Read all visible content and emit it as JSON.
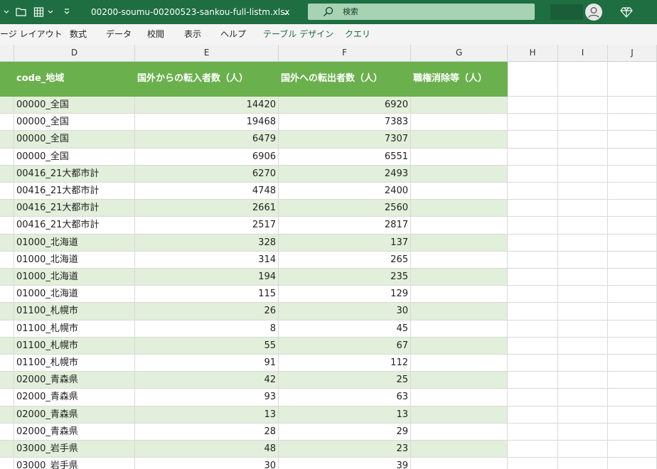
{
  "titlebar": {
    "filename": "00200-soumu-00200523-sankou-full-listm.xlsx",
    "filename_chevron": "⌄",
    "search_label": "検索",
    "icons": [
      "chevron-down-icon",
      "folder-icon",
      "table-icon",
      "dropdown-icon",
      "search-icon",
      "avatar-icon",
      "diamond-icon"
    ]
  },
  "menu": {
    "items": [
      {
        "label": "ージ レイアウト",
        "contextual": false
      },
      {
        "label": "数式",
        "contextual": false
      },
      {
        "label": "データ",
        "contextual": false
      },
      {
        "label": "校閲",
        "contextual": false
      },
      {
        "label": "表示",
        "contextual": false
      },
      {
        "label": "ヘルプ",
        "contextual": false
      },
      {
        "label": "テーブル デザイン",
        "contextual": true
      },
      {
        "label": "クエリ",
        "contextual": true
      }
    ]
  },
  "columns": [
    "D",
    "E",
    "F",
    "G",
    "H",
    "I",
    "J"
  ],
  "table": {
    "headers": [
      "code_地域",
      "国外からの転入者数（人）",
      "国外への転出者数（人）",
      "職権消除等（人）"
    ],
    "rows": [
      [
        "00000_全国",
        "14420",
        "6920",
        ""
      ],
      [
        "00000_全国",
        "19468",
        "7383",
        ""
      ],
      [
        "00000_全国",
        "6479",
        "7307",
        ""
      ],
      [
        "00000_全国",
        "6906",
        "6551",
        ""
      ],
      [
        "00416_21大都市計",
        "6270",
        "2493",
        ""
      ],
      [
        "00416_21大都市計",
        "4748",
        "2400",
        ""
      ],
      [
        "00416_21大都市計",
        "2661",
        "2560",
        ""
      ],
      [
        "00416_21大都市計",
        "2517",
        "2817",
        ""
      ],
      [
        "01000_北海道",
        "328",
        "137",
        ""
      ],
      [
        "01000_北海道",
        "314",
        "265",
        ""
      ],
      [
        "01000_北海道",
        "194",
        "235",
        ""
      ],
      [
        "01000_北海道",
        "115",
        "129",
        ""
      ],
      [
        "01100_札幌市",
        "26",
        "30",
        ""
      ],
      [
        "01100_札幌市",
        "8",
        "45",
        ""
      ],
      [
        "01100_札幌市",
        "55",
        "67",
        ""
      ],
      [
        "01100_札幌市",
        "91",
        "112",
        ""
      ],
      [
        "02000_青森県",
        "42",
        "25",
        ""
      ],
      [
        "02000_青森県",
        "93",
        "63",
        ""
      ],
      [
        "02000_青森県",
        "13",
        "13",
        ""
      ],
      [
        "02000_青森県",
        "28",
        "29",
        ""
      ],
      [
        "03000_岩手県",
        "48",
        "23",
        ""
      ],
      [
        "03000_岩手県",
        "30",
        "39",
        ""
      ]
    ]
  },
  "colors": {
    "titlebar": "#1e6e42",
    "table_header": "#6ab04c",
    "band": "#e2efda"
  }
}
